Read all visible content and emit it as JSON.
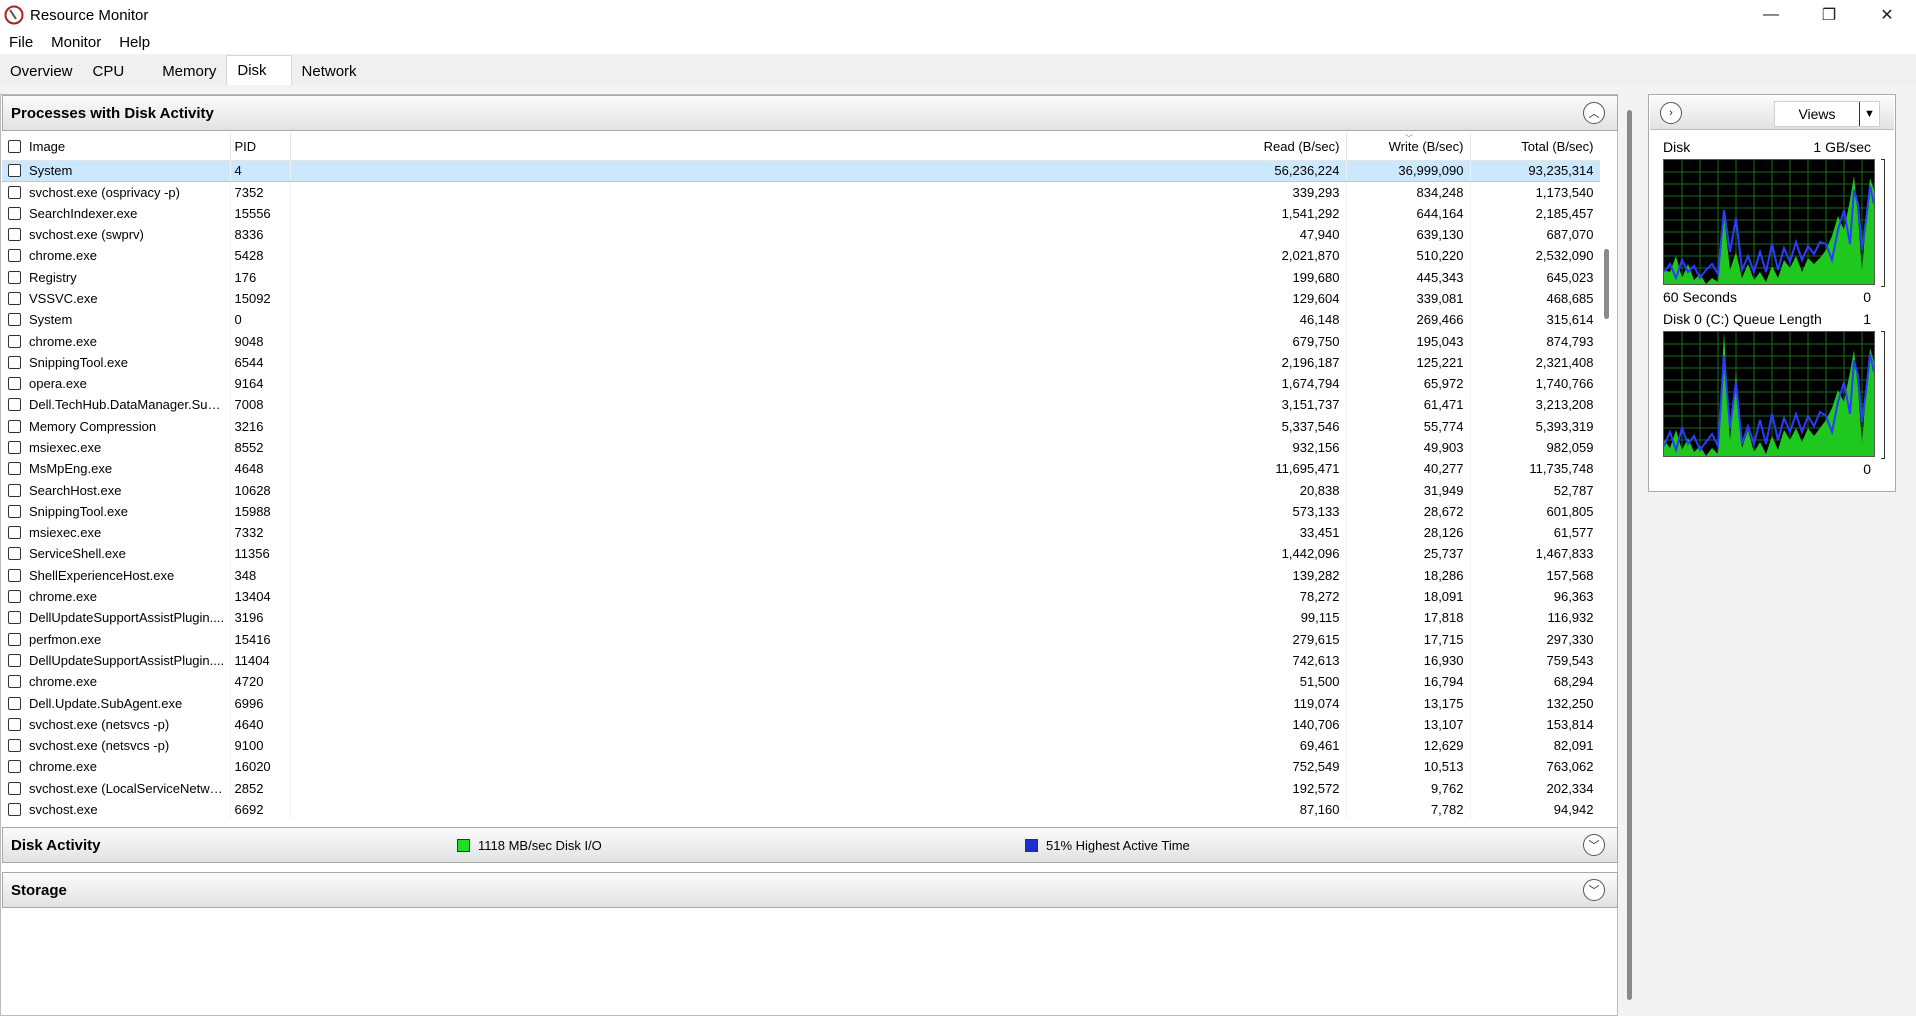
{
  "window": {
    "title": "Resource Monitor",
    "minimize": "—",
    "restore": "❐",
    "close": "✕"
  },
  "menu": [
    "File",
    "Monitor",
    "Help"
  ],
  "tabs": [
    "Overview",
    "CPU",
    "Memory",
    "Disk",
    "Network"
  ],
  "active_tab": "Disk",
  "processes": {
    "title": "Processes with Disk Activity",
    "columns": [
      "Image",
      "PID",
      "Read (B/sec)",
      "Write (B/sec)",
      "Total (B/sec)"
    ],
    "sorted_column": "Write (B/sec)",
    "rows": [
      {
        "image": "System",
        "pid": "4",
        "read": "56,236,224",
        "write": "36,999,090",
        "total": "93,235,314"
      },
      {
        "image": "svchost.exe (osprivacy -p)",
        "pid": "7352",
        "read": "339,293",
        "write": "834,248",
        "total": "1,173,540"
      },
      {
        "image": "SearchIndexer.exe",
        "pid": "15556",
        "read": "1,541,292",
        "write": "644,164",
        "total": "2,185,457"
      },
      {
        "image": "svchost.exe (swprv)",
        "pid": "8336",
        "read": "47,940",
        "write": "639,130",
        "total": "687,070"
      },
      {
        "image": "chrome.exe",
        "pid": "5428",
        "read": "2,021,870",
        "write": "510,220",
        "total": "2,532,090"
      },
      {
        "image": "Registry",
        "pid": "176",
        "read": "199,680",
        "write": "445,343",
        "total": "645,023"
      },
      {
        "image": "VSSVC.exe",
        "pid": "15092",
        "read": "129,604",
        "write": "339,081",
        "total": "468,685"
      },
      {
        "image": "System",
        "pid": "0",
        "read": "46,148",
        "write": "269,466",
        "total": "315,614"
      },
      {
        "image": "chrome.exe",
        "pid": "9048",
        "read": "679,750",
        "write": "195,043",
        "total": "874,793"
      },
      {
        "image": "SnippingTool.exe",
        "pid": "6544",
        "read": "2,196,187",
        "write": "125,221",
        "total": "2,321,408"
      },
      {
        "image": "opera.exe",
        "pid": "9164",
        "read": "1,674,794",
        "write": "65,972",
        "total": "1,740,766"
      },
      {
        "image": "Dell.TechHub.DataManager.Sub...",
        "pid": "7008",
        "read": "3,151,737",
        "write": "61,471",
        "total": "3,213,208"
      },
      {
        "image": "Memory Compression",
        "pid": "3216",
        "read": "5,337,546",
        "write": "55,774",
        "total": "5,393,319"
      },
      {
        "image": "msiexec.exe",
        "pid": "8552",
        "read": "932,156",
        "write": "49,903",
        "total": "982,059"
      },
      {
        "image": "MsMpEng.exe",
        "pid": "4648",
        "read": "11,695,471",
        "write": "40,277",
        "total": "11,735,748"
      },
      {
        "image": "SearchHost.exe",
        "pid": "10628",
        "read": "20,838",
        "write": "31,949",
        "total": "52,787"
      },
      {
        "image": "SnippingTool.exe",
        "pid": "15988",
        "read": "573,133",
        "write": "28,672",
        "total": "601,805"
      },
      {
        "image": "msiexec.exe",
        "pid": "7332",
        "read": "33,451",
        "write": "28,126",
        "total": "61,577"
      },
      {
        "image": "ServiceShell.exe",
        "pid": "11356",
        "read": "1,442,096",
        "write": "25,737",
        "total": "1,467,833"
      },
      {
        "image": "ShellExperienceHost.exe",
        "pid": "348",
        "read": "139,282",
        "write": "18,286",
        "total": "157,568"
      },
      {
        "image": "chrome.exe",
        "pid": "13404",
        "read": "78,272",
        "write": "18,091",
        "total": "96,363"
      },
      {
        "image": "DellUpdateSupportAssistPlugin....",
        "pid": "3196",
        "read": "99,115",
        "write": "17,818",
        "total": "116,932"
      },
      {
        "image": "perfmon.exe",
        "pid": "15416",
        "read": "279,615",
        "write": "17,715",
        "total": "297,330"
      },
      {
        "image": "DellUpdateSupportAssistPlugin....",
        "pid": "11404",
        "read": "742,613",
        "write": "16,930",
        "total": "759,543"
      },
      {
        "image": "chrome.exe",
        "pid": "4720",
        "read": "51,500",
        "write": "16,794",
        "total": "68,294"
      },
      {
        "image": "Dell.Update.SubAgent.exe",
        "pid": "6996",
        "read": "119,074",
        "write": "13,175",
        "total": "132,250"
      },
      {
        "image": "svchost.exe (netsvcs -p)",
        "pid": "4640",
        "read": "140,706",
        "write": "13,107",
        "total": "153,814"
      },
      {
        "image": "svchost.exe (netsvcs -p)",
        "pid": "9100",
        "read": "69,461",
        "write": "12,629",
        "total": "82,091"
      },
      {
        "image": "chrome.exe",
        "pid": "16020",
        "read": "752,549",
        "write": "10,513",
        "total": "763,062"
      },
      {
        "image": "svchost.exe (LocalServiceNetwo...",
        "pid": "2852",
        "read": "192,572",
        "write": "9,762",
        "total": "202,334"
      },
      {
        "image": "svchost.exe",
        "pid": "6692",
        "read": "87,160",
        "write": "7,782",
        "total": "94,942"
      }
    ]
  },
  "disk_activity": {
    "title": "Disk Activity",
    "io_label": "1118 MB/sec Disk I/O",
    "io_color": "#22dd22",
    "active_label": "51% Highest Active Time",
    "active_color": "#1a2fcc"
  },
  "storage": {
    "title": "Storage"
  },
  "right_panel": {
    "views_label": "Views",
    "graph1": {
      "title": "Disk",
      "max": "1 GB/sec",
      "time": "60 Seconds",
      "min": "0"
    },
    "graph2": {
      "title": "Disk 0 (C:) Queue Length",
      "max": "1",
      "min": "0"
    }
  }
}
